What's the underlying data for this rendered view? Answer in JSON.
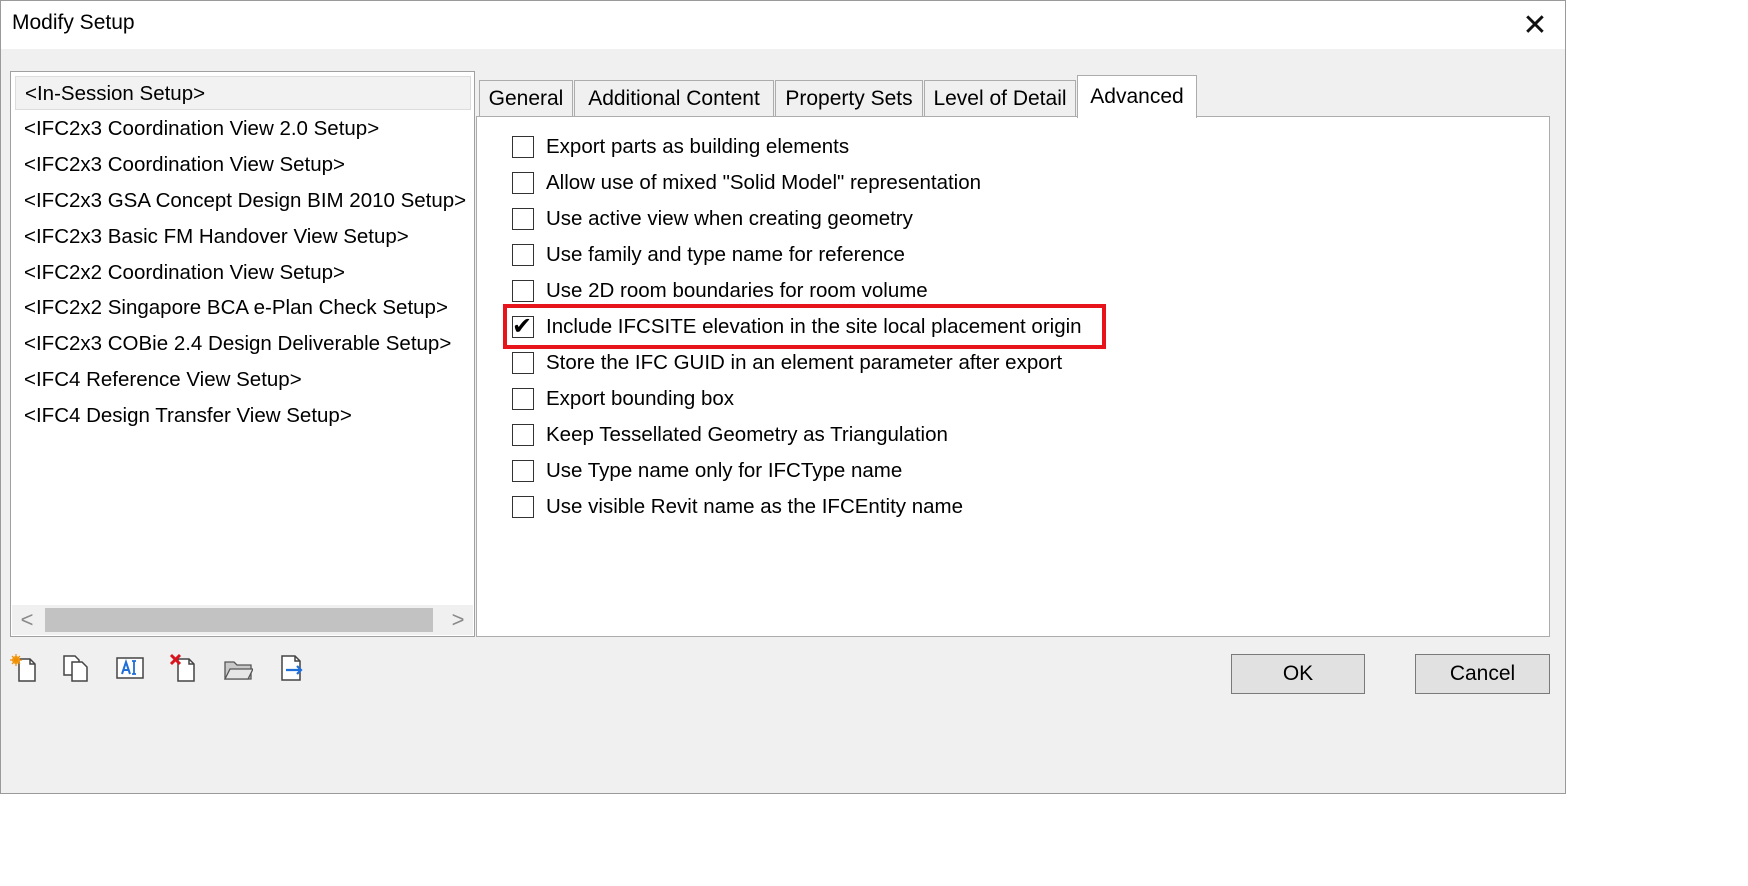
{
  "window": {
    "title": "Modify Setup",
    "close_glyph": "✕"
  },
  "setups": [
    {
      "label": "<In-Session Setup>",
      "selected": true
    },
    {
      "label": "<IFC2x3 Coordination View 2.0 Setup>",
      "selected": false
    },
    {
      "label": "<IFC2x3 Coordination View Setup>",
      "selected": false
    },
    {
      "label": "<IFC2x3 GSA Concept Design BIM 2010 Setup>",
      "selected": false
    },
    {
      "label": "<IFC2x3 Basic FM Handover View Setup>",
      "selected": false
    },
    {
      "label": "<IFC2x2 Coordination View Setup>",
      "selected": false
    },
    {
      "label": "<IFC2x2 Singapore BCA e-Plan Check Setup>",
      "selected": false
    },
    {
      "label": "<IFC2x3 COBie 2.4 Design Deliverable Setup>",
      "selected": false
    },
    {
      "label": "<IFC4 Reference View Setup>",
      "selected": false
    },
    {
      "label": "<IFC4 Design Transfer View Setup>",
      "selected": false
    }
  ],
  "scrollbar": {
    "left_arrow": "<",
    "right_arrow": ">"
  },
  "tabs": [
    {
      "label": "General",
      "active": false
    },
    {
      "label": "Additional Content",
      "active": false
    },
    {
      "label": "Property Sets",
      "active": false
    },
    {
      "label": "Level of Detail",
      "active": false
    },
    {
      "label": "Advanced",
      "active": true
    }
  ],
  "advanced_options": [
    {
      "label": "Export parts as building elements",
      "checked": false
    },
    {
      "label": "Allow use of mixed \"Solid Model\" representation",
      "checked": false
    },
    {
      "label": "Use active view when creating geometry",
      "checked": false
    },
    {
      "label": "Use family and type name for reference",
      "checked": false
    },
    {
      "label": "Use 2D room boundaries for room volume",
      "checked": false
    },
    {
      "label": "Include IFCSITE elevation in the site local placement origin",
      "checked": true
    },
    {
      "label": "Store the IFC GUID in an element parameter after export",
      "checked": false
    },
    {
      "label": "Export bounding box",
      "checked": false
    },
    {
      "label": "Keep Tessellated Geometry as Triangulation",
      "checked": false
    },
    {
      "label": "Use Type name only for IFCType name",
      "checked": false
    },
    {
      "label": "Use visible Revit name as the IFCEntity name",
      "checked": false
    }
  ],
  "check_glyph": "✔",
  "toolbar_icons": [
    "new-setup-icon",
    "duplicate-setup-icon",
    "rename-setup-icon",
    "delete-setup-icon",
    "import-setup-icon",
    "export-setup-icon"
  ],
  "buttons": {
    "ok": "OK",
    "cancel": "Cancel"
  },
  "colors": {
    "highlight": "#e8141c",
    "window_bg": "#f0f0f0"
  }
}
